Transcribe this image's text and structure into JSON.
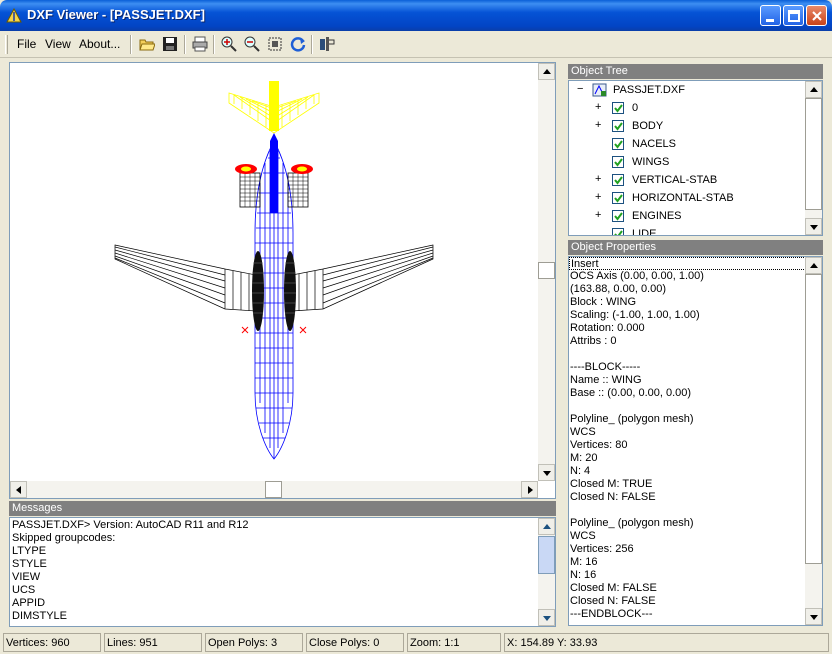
{
  "window": {
    "title": "DXF Viewer - [PASSJET.DXF]"
  },
  "menu": {
    "file": "File",
    "view": "View",
    "about": "About..."
  },
  "toolbar": {
    "icons": [
      "open-folder-icon",
      "save-disk-icon",
      "print-icon",
      "zoom-in-icon",
      "zoom-out-icon",
      "zoom-extents-icon",
      "refresh-icon",
      "layers-icon"
    ]
  },
  "panels": {
    "messages_title": "Messages",
    "tree_title": "Object Tree",
    "props_title": "Object Properties"
  },
  "messages": [
    "PASSJET.DXF> Version: AutoCAD R11 and R12",
    "Skipped groupcodes:",
    "LTYPE",
    "STYLE",
    "VIEW",
    "UCS",
    "APPID",
    "DIMSTYLE"
  ],
  "tree": {
    "root": "PASSJET.DXF",
    "layers": [
      {
        "name": "0",
        "expandable": true,
        "checked": true
      },
      {
        "name": "BODY",
        "expandable": true,
        "checked": true
      },
      {
        "name": "NACELS",
        "expandable": false,
        "checked": true
      },
      {
        "name": "WINGS",
        "expandable": false,
        "checked": true
      },
      {
        "name": "VERTICAL-STAB",
        "expandable": true,
        "checked": true
      },
      {
        "name": "HORIZONTAL-STAB",
        "expandable": true,
        "checked": true
      },
      {
        "name": "ENGINES",
        "expandable": true,
        "checked": true
      },
      {
        "name": "LIDE",
        "expandable": false,
        "checked": true
      }
    ]
  },
  "properties": [
    "Insert",
    "OCS Axis (0.00, 0.00, 1.00)",
    "(163.88, 0.00, 0.00)",
    "Block : WING",
    "Scaling: (-1.00, 1.00, 1.00)",
    "Rotation: 0.000",
    "Attribs : 0",
    "",
    "----BLOCK-----",
    "Name :: WING",
    "Base :: (0.00, 0.00, 0.00)",
    "",
    "Polyline_ (polygon mesh)",
    "WCS",
    "Vertices: 80",
    "M: 20",
    "N: 4",
    "Closed M: TRUE",
    "Closed N: FALSE",
    "",
    "Polyline_ (polygon mesh)",
    "WCS",
    "Vertices: 256",
    "M: 16",
    "N: 16",
    "Closed M: FALSE",
    "Closed N: FALSE",
    "---ENDBLOCK---"
  ],
  "status": {
    "vertices": "Vertices: 960",
    "lines": "Lines: 951",
    "open_polys": "Open Polys: 3",
    "close_polys": "Close Polys: 0",
    "zoom": "Zoom: 1:1",
    "coords": "X: 154.89  Y: 33.93"
  },
  "colors": {
    "fuselage": "#0000ff",
    "wings": "#000000",
    "tail": "#ffff00",
    "engine_tips": "#ff0000"
  }
}
